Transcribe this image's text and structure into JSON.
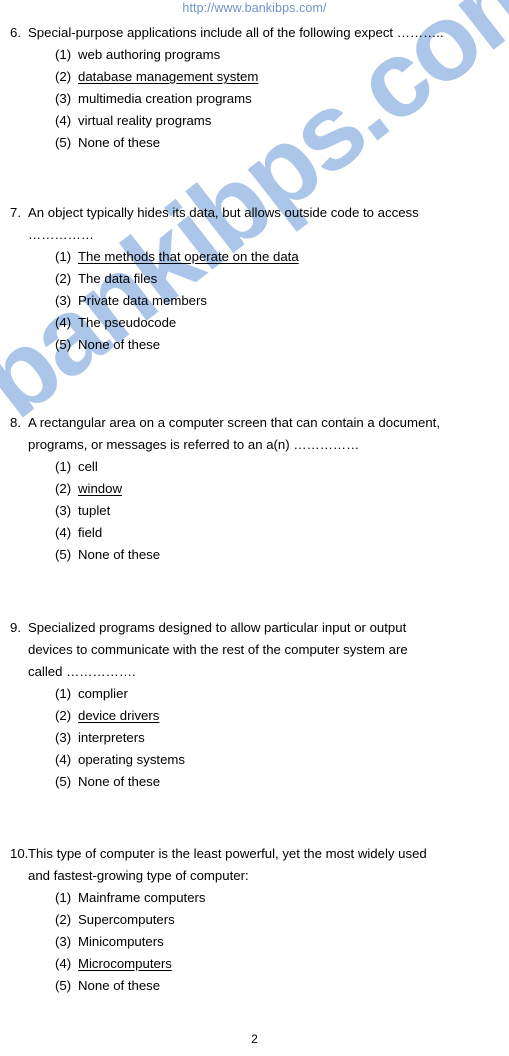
{
  "header": {
    "url": "http://www.bankibps.com/"
  },
  "watermark": {
    "text": "bankibps.com",
    "color": "#abc6e8"
  },
  "footer": {
    "page_number": "2"
  },
  "document": {
    "questions": [
      {
        "number": "6.",
        "lines": [
          "Special-purpose applications include all of the following expect ……….."
        ],
        "options": [
          {
            "marker": "(1)",
            "text": "web authoring programs",
            "answer": false
          },
          {
            "marker": "(2)",
            "text": "database management system",
            "answer": true
          },
          {
            "marker": "(3)",
            "text": "multimedia creation programs",
            "answer": false
          },
          {
            "marker": "(4)",
            "text": "virtual reality programs",
            "answer": false
          },
          {
            "marker": "(5)",
            "text": "None of these",
            "answer": false
          }
        ]
      },
      {
        "number": "7.",
        "lines": [
          "An object typically hides its data, but allows outside code to access",
          "……………"
        ],
        "options": [
          {
            "marker": "(1)",
            "text": "The methods that operate on the data",
            "answer": true
          },
          {
            "marker": "(2)",
            "text": "The data files",
            "answer": false
          },
          {
            "marker": "(3)",
            "text": "Private data members",
            "answer": false
          },
          {
            "marker": "(4)",
            "text": "The pseudocode",
            "answer": false
          },
          {
            "marker": "(5)",
            "text": "None of these",
            "answer": false
          }
        ]
      },
      {
        "number": "8.",
        "lines": [
          "A rectangular area on a computer screen that can contain a document,",
          "programs, or messages is referred to an a(n) ……………"
        ],
        "options": [
          {
            "marker": "(1)",
            "text": "cell",
            "answer": false
          },
          {
            "marker": "(2)",
            "text": "window",
            "answer": true
          },
          {
            "marker": "(3)",
            "text": "tuplet",
            "answer": false
          },
          {
            "marker": "(4)",
            "text": "field",
            "answer": false
          },
          {
            "marker": "(5)",
            "text": "None of these",
            "answer": false
          }
        ]
      },
      {
        "number": "9.",
        "lines": [
          "Specialized programs designed to allow particular input or output",
          "devices to communicate with the rest of the computer system are",
          "called ……………."
        ],
        "options": [
          {
            "marker": "(1)",
            "text": "complier",
            "answer": false
          },
          {
            "marker": "(2)",
            "text": "device drivers",
            "answer": true
          },
          {
            "marker": "(3)",
            "text": "interpreters",
            "answer": false
          },
          {
            "marker": "(4)",
            "text": "operating systems",
            "answer": false
          },
          {
            "marker": "(5)",
            "text": "None of these",
            "answer": false
          }
        ]
      },
      {
        "number": "10.",
        "lines": [
          "This type of computer is the least powerful, yet the most widely used",
          "and fastest-growing type of computer:"
        ],
        "options": [
          {
            "marker": "(1)",
            "text": "Mainframe computers",
            "answer": false
          },
          {
            "marker": "(2)",
            "text": "Supercomputers",
            "answer": false
          },
          {
            "marker": "(3)",
            "text": "Minicomputers",
            "answer": false
          },
          {
            "marker": "(4)",
            "text": "Microcomputers",
            "answer": true
          },
          {
            "marker": "(5)",
            "text": "None of these",
            "answer": false
          }
        ]
      }
    ]
  }
}
